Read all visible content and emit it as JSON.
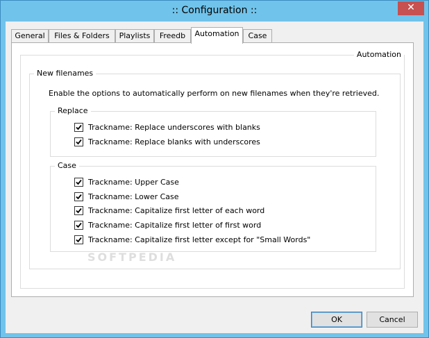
{
  "window": {
    "title": ":: Configuration ::",
    "close_symbol": "✕"
  },
  "tabs": [
    {
      "label": "General"
    },
    {
      "label": "Files & Folders"
    },
    {
      "label": "Playlists"
    },
    {
      "label": "Freedb"
    },
    {
      "label": "Automation",
      "active": true
    },
    {
      "label": "Case"
    }
  ],
  "panel": {
    "outer_group_label": "Automation",
    "new_filenames": {
      "label": "New filenames",
      "description": "Enable the options to automatically perform on new filenames when they're retrieved.",
      "replace": {
        "label": "Replace",
        "items": [
          {
            "label": "Trackname: Replace underscores with blanks",
            "checked": true
          },
          {
            "label": "Trackname: Replace blanks with underscores",
            "checked": true
          }
        ]
      },
      "case": {
        "label": "Case",
        "items": [
          {
            "label": "Trackname: Upper Case",
            "checked": true
          },
          {
            "label": "Trackname: Lower Case",
            "checked": true
          },
          {
            "label": "Trackname: Capitalize first letter of each word",
            "checked": true
          },
          {
            "label": "Trackname: Capitalize first letter of first word",
            "checked": true
          },
          {
            "label": "Trackname: Capitalize first letter except for \"Small Words\"",
            "checked": true
          }
        ]
      }
    }
  },
  "buttons": {
    "ok": "OK",
    "cancel": "Cancel"
  },
  "watermark": "SOFTPEDIA",
  "colors": {
    "titlebar": "#70c3ea",
    "close": "#c75050",
    "face": "#f0f0f0"
  }
}
